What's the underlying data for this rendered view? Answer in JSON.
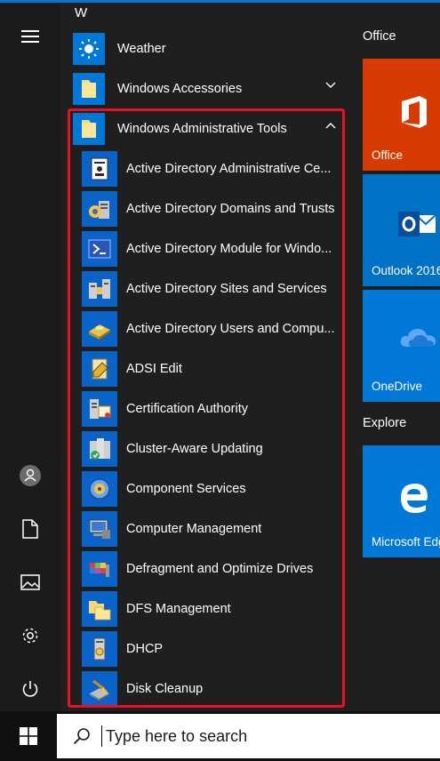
{
  "app_list": {
    "letter_header": "W",
    "items": [
      {
        "label": "Weather",
        "icon": "weather-icon"
      },
      {
        "label": "Windows Accessories",
        "icon": "folder-icon",
        "chevron": "down"
      },
      {
        "label": "Windows Administrative Tools",
        "icon": "folder-icon",
        "chevron": "up"
      }
    ],
    "sub_items": [
      {
        "label": "Active Directory Administrative Ce...",
        "icon": "ad-admin-center-icon"
      },
      {
        "label": "Active Directory Domains and Trusts",
        "icon": "ad-domains-trusts-icon"
      },
      {
        "label": "Active Directory Module for Windo...",
        "icon": "powershell-icon"
      },
      {
        "label": "Active Directory Sites and Services",
        "icon": "ad-sites-services-icon"
      },
      {
        "label": "Active Directory Users and Compu...",
        "icon": "ad-users-computers-icon"
      },
      {
        "label": "ADSI Edit",
        "icon": "adsi-edit-icon"
      },
      {
        "label": "Certification Authority",
        "icon": "certification-authority-icon"
      },
      {
        "label": "Cluster-Aware Updating",
        "icon": "cluster-aware-updating-icon"
      },
      {
        "label": "Component Services",
        "icon": "component-services-icon"
      },
      {
        "label": "Computer Management",
        "icon": "computer-management-icon"
      },
      {
        "label": "Defragment and Optimize Drives",
        "icon": "defragment-icon"
      },
      {
        "label": "DFS Management",
        "icon": "dfs-management-icon"
      },
      {
        "label": "DHCP",
        "icon": "dhcp-icon"
      },
      {
        "label": "Disk Cleanup",
        "icon": "disk-cleanup-icon"
      }
    ]
  },
  "tiles": {
    "groups": [
      {
        "title": "Office",
        "tiles": [
          {
            "label": "Office",
            "color": "#d83b01",
            "icon": "office-icon"
          },
          {
            "label": "Outlook 2016",
            "color": "#0072c6",
            "icon": "outlook-icon"
          },
          {
            "label": "OneDrive",
            "color": "#0078d7",
            "icon": "onedrive-icon"
          }
        ]
      },
      {
        "title": "Explore",
        "tiles": [
          {
            "label": "Microsoft Edge",
            "color": "#0078d7",
            "icon": "edge-icon"
          }
        ]
      }
    ]
  },
  "taskbar": {
    "search_placeholder": "Type here to search"
  },
  "colors": {
    "accent": "#0078d7",
    "highlight_border": "#e81123",
    "menu_bg": "#1f1f1f"
  }
}
